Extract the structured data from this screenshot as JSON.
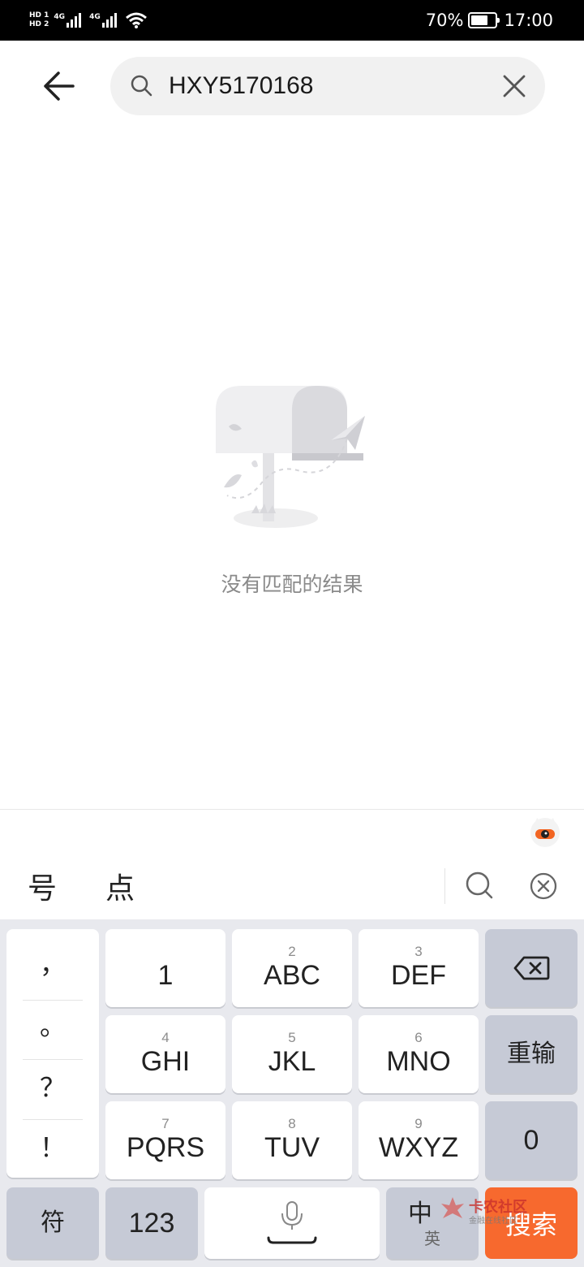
{
  "status_bar": {
    "hd1": "HD 1",
    "hd2": "HD 2",
    "net1": "4G",
    "net2": "4G",
    "battery": "70%",
    "battery_level": 0.7,
    "time": "17:00"
  },
  "header": {
    "back_icon": "arrow-left-icon",
    "search_icon": "search-icon",
    "search_value": "HXY5170168",
    "clear_icon": "close-icon"
  },
  "empty_state": {
    "illustration": "empty-mailbox-illustration",
    "message": "没有匹配的结果"
  },
  "keyboard": {
    "candidates": [
      "号",
      "点"
    ],
    "mascot_icon": "keyboard-mascot-icon",
    "search_icon": "search-icon",
    "close_icon": "close-circle-icon",
    "punctuation": [
      "，",
      "。",
      "？",
      "！"
    ],
    "t9_keys": [
      {
        "num": "",
        "main": "1"
      },
      {
        "num": "2",
        "main": "ABC"
      },
      {
        "num": "3",
        "main": "DEF"
      },
      {
        "num": "4",
        "main": "GHI"
      },
      {
        "num": "5",
        "main": "JKL"
      },
      {
        "num": "6",
        "main": "MNO"
      },
      {
        "num": "7",
        "main": "PQRS"
      },
      {
        "num": "8",
        "main": "TUV"
      },
      {
        "num": "9",
        "main": "WXYZ"
      }
    ],
    "backspace_icon": "backspace-icon",
    "reinput_label": "重输",
    "zero_label": "0",
    "symbol_label": "符",
    "numeric_label": "123",
    "mic_icon": "microphone-icon",
    "lang_main": "中",
    "lang_sub": "英",
    "search_label": "搜索",
    "watermark_title": "卡农社区",
    "watermark_sub": "金融在线社区"
  }
}
